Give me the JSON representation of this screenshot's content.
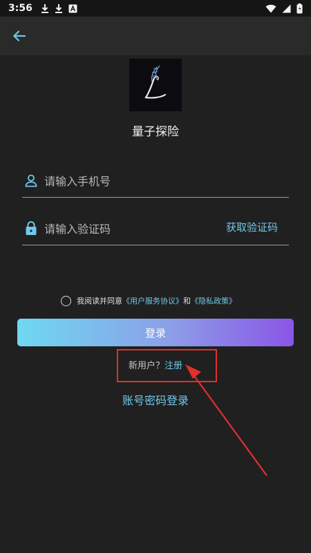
{
  "status_bar": {
    "time": "3:56",
    "left_icons": [
      "download-icon",
      "download-icon",
      "app-notification-icon"
    ],
    "right_icons": [
      "wifi-icon",
      "signal-icon",
      "battery-icon"
    ]
  },
  "app_bar": {
    "back_icon": "back-arrow-icon"
  },
  "app": {
    "name": "量子探险"
  },
  "form": {
    "phone_placeholder": "请输入手机号",
    "code_placeholder": "请输入验证码",
    "get_code_label": "获取验证码"
  },
  "agreement": {
    "prefix": "我阅读并同意",
    "terms_link": "《用户服务协议》",
    "and": "和",
    "privacy_link": "《隐私政策》",
    "checked": false
  },
  "login_button_label": "登录",
  "register": {
    "prompt": "新用户？",
    "link": "注册"
  },
  "password_login_label": "账号密码登录",
  "colors": {
    "accent": "#6fc9ea",
    "background": "#202020",
    "annotation_red": "#e2302c",
    "button_gradient": [
      "#6ed9f1",
      "#8a55e6"
    ]
  }
}
